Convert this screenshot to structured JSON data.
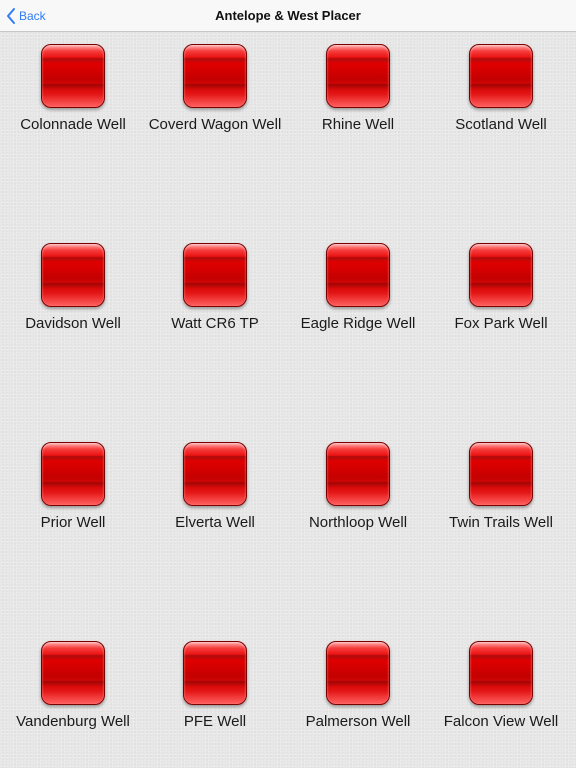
{
  "nav": {
    "back_label": "Back",
    "title": "Antelope & West Placer"
  },
  "wells": [
    {
      "label": "Colonnade Well"
    },
    {
      "label": "Coverd Wagon Well"
    },
    {
      "label": "Rhine Well"
    },
    {
      "label": "Scotland Well"
    },
    {
      "label": "Davidson Well"
    },
    {
      "label": "Watt CR6 TP"
    },
    {
      "label": "Eagle Ridge Well"
    },
    {
      "label": "Fox Park Well"
    },
    {
      "label": "Prior Well"
    },
    {
      "label": "Elverta Well"
    },
    {
      "label": "Northloop Well"
    },
    {
      "label": "Twin Trails Well"
    },
    {
      "label": "Vandenburg Well"
    },
    {
      "label": "PFE Well"
    },
    {
      "label": "Palmerson Well"
    },
    {
      "label": "Falcon View Well"
    }
  ],
  "colors": {
    "accent": "#2f7cf6",
    "button_red": "#e00000"
  }
}
